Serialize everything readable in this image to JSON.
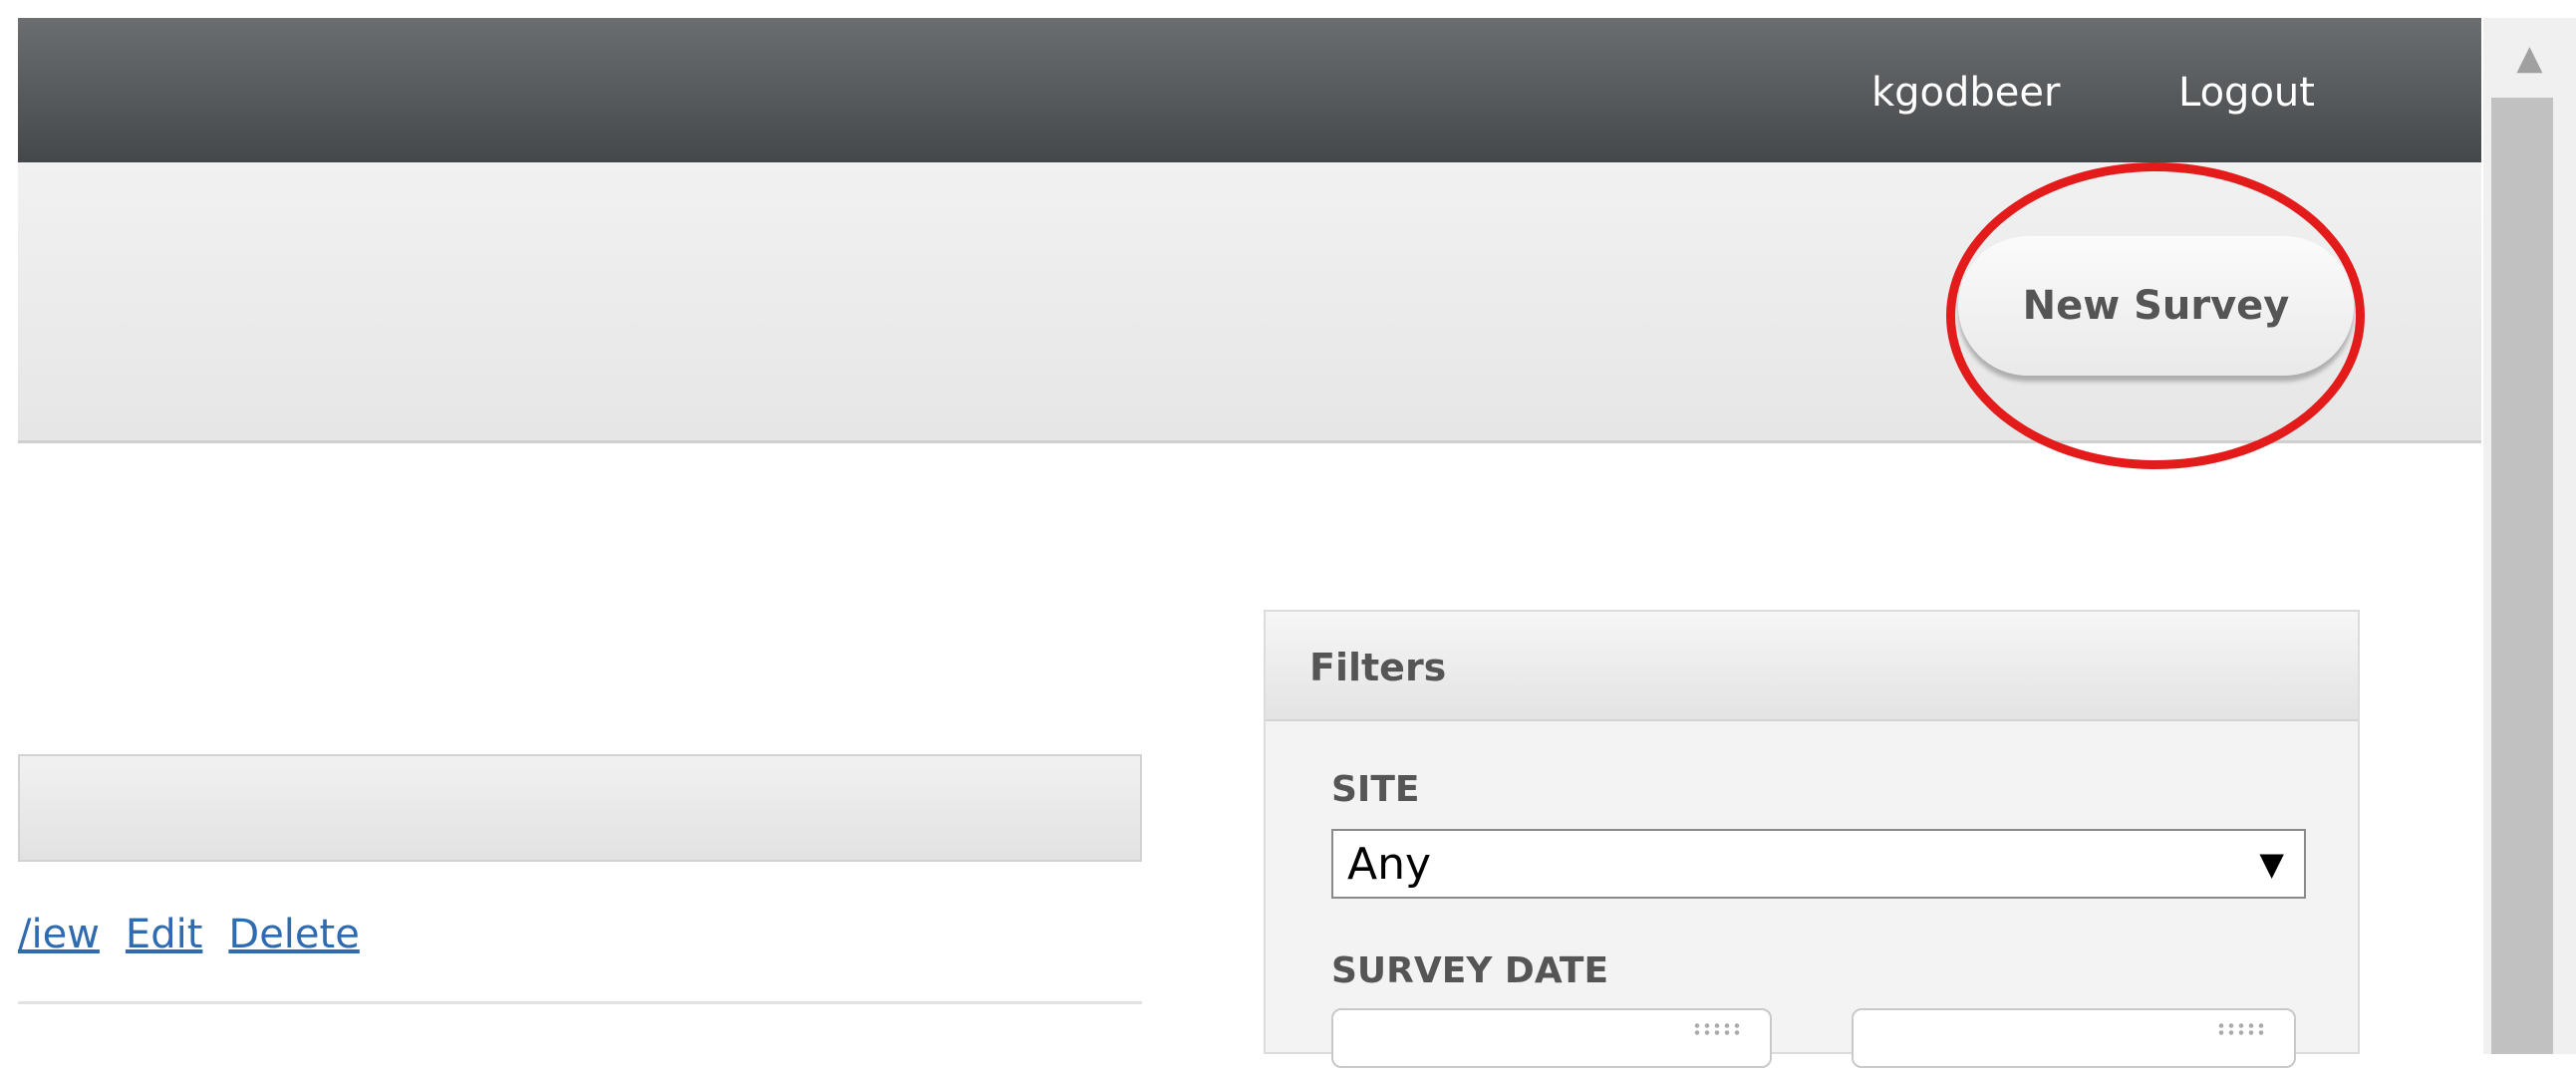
{
  "header": {
    "username": "kgodbeer",
    "logout_label": "Logout"
  },
  "toolbar": {
    "new_survey_label": "New Survey",
    "annotation_color": "#e31b1b"
  },
  "list": {
    "actions": [
      "View",
      "Edit",
      "Delete"
    ],
    "view_label_visible": "/iew"
  },
  "filters": {
    "title": "Filters",
    "site_label": "SITE",
    "site_value": "Any",
    "survey_date_label": "SURVEY DATE"
  },
  "icons": {
    "dropdown": "triangle-down",
    "calendar": "calendar-icon",
    "scroll_up": "triangle-up"
  }
}
